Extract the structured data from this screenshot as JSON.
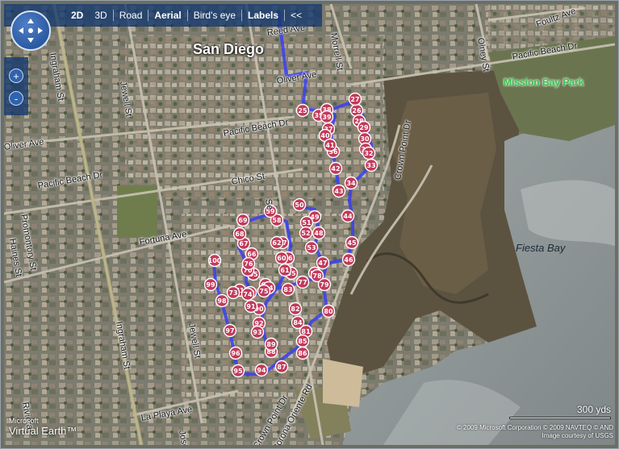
{
  "toolbar": {
    "items": [
      "2D",
      "3D",
      "Road",
      "Aerial",
      "Bird's eye",
      "Labels",
      "<<"
    ],
    "active": [
      "2D",
      "Aerial",
      "Labels"
    ]
  },
  "zoom": {
    "in": "+",
    "out": "-"
  },
  "place_labels": {
    "city": "San Diego",
    "park": "Mission Bay Park",
    "bay": "Fiesta Bay"
  },
  "streets": {
    "reed_ave": "Reed Ave",
    "oliver_ave_top": "Oliver Ave",
    "oliver_ave_left": "Oliver Ave",
    "pacific_beach_dr_mid": "Pacific Beach Dr",
    "pacific_beach_dr_left": "Pacific Beach Dr",
    "pacific_beach_dr_right": "Pacific Beach Dr",
    "chico_st": "Chico St",
    "fortuna_ave": "Fortuna Ave",
    "la_playa_ave": "La Playa Ave",
    "foultz_ave": "Foultz Ave",
    "morrell_st": "Morrell St",
    "olney_st": "Olney St",
    "jewell_st_top": "Jewell St",
    "jewell_st_bottom": "Jewell St",
    "ingraham_st_top": "Ingraham St",
    "ingraham_st_bottom": "Ingraham St",
    "crown_point_dr_right": "Crown Point Dr",
    "crown_point_dr_bottom": "Crown Point Dr",
    "corona_oriente_rd": "Corona Oriente Rd",
    "promontory_st": "Promontory St",
    "haines_st": "Haines St",
    "riviera": "Riviera",
    "jose": "Jose",
    "se": "Se"
  },
  "route": {
    "color": "#3b3ff0",
    "marker_color": "#c23a5a",
    "markers": [
      "25",
      "26",
      "27",
      "28",
      "29",
      "30",
      "31",
      "32",
      "33",
      "34",
      "35",
      "36",
      "37",
      "38",
      "39",
      "40",
      "41",
      "42",
      "43",
      "44",
      "45",
      "46",
      "47",
      "48",
      "49",
      "50",
      "51",
      "52",
      "53",
      "54",
      "55",
      "56",
      "57",
      "58",
      "59",
      "60",
      "61",
      "62",
      "63",
      "64",
      "65",
      "66",
      "67",
      "68",
      "69",
      "70",
      "71",
      "72",
      "73",
      "74",
      "75",
      "76",
      "77",
      "78",
      "79",
      "80",
      "81",
      "82",
      "83",
      "84",
      "85",
      "86",
      "87",
      "88",
      "89",
      "90",
      "91",
      "92",
      "93",
      "94",
      "95",
      "96",
      "97",
      "98",
      "99",
      "100"
    ]
  },
  "scale": {
    "label": "300 yds"
  },
  "copyright": {
    "line1": "© 2009 Microsoft Corporation  © 2009 NAVTEQ  © AND",
    "line2": "Image courtesy of USGS"
  },
  "brand": {
    "line1": "Microsoft",
    "line2": "Virtual Earth™"
  }
}
